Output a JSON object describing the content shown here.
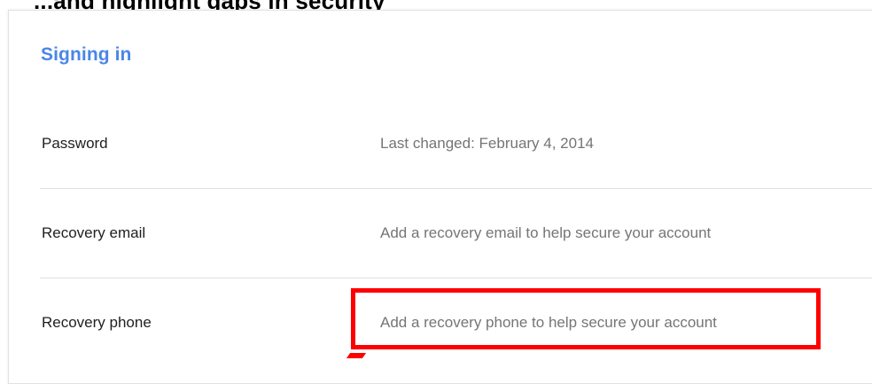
{
  "top_text": "...and highlight gaps in security",
  "section": {
    "title": "Signing in"
  },
  "rows": [
    {
      "label": "Password",
      "value": "Last changed: February 4, 2014"
    },
    {
      "label": "Recovery email",
      "value": "Add a recovery email to help secure your account"
    },
    {
      "label": "Recovery phone",
      "value": "Add a recovery phone to help secure your account"
    }
  ],
  "colors": {
    "section_title": "#4a86e8",
    "highlight": "#ff0000",
    "label": "#212121",
    "value": "#757575",
    "divider": "#e0e0e0"
  }
}
